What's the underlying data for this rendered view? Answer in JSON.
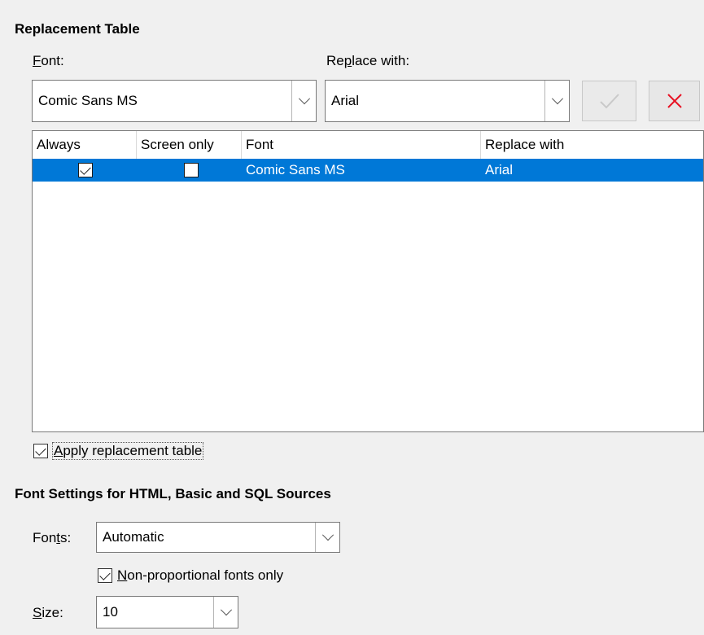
{
  "replacement": {
    "heading": "Replacement Table",
    "font_label_pre": "",
    "font_label_mn": "F",
    "font_label_post": "ont:",
    "replace_label_pre": "Re",
    "replace_label_mn": "p",
    "replace_label_post": "lace with:",
    "font_value": "Comic Sans MS",
    "replace_value": "Arial",
    "apply_icon": "check-icon",
    "delete_icon": "close-icon",
    "delete_color": "#e81123"
  },
  "table": {
    "columns": [
      "Always",
      "Screen only",
      "Font",
      "Replace with"
    ],
    "rows": [
      {
        "always": true,
        "screen_only": false,
        "font": "Comic Sans MS",
        "replace_with": "Arial"
      }
    ],
    "selected_color": "#0078d7"
  },
  "apply_table": {
    "checked": true,
    "label_mn": "A",
    "label_rest": "pply replacement table"
  },
  "sources": {
    "heading": "Font Settings for HTML, Basic and SQL Sources",
    "fonts_label_pre": "Fon",
    "fonts_label_mn": "t",
    "fonts_label_post": "s:",
    "fonts_value": "Automatic",
    "nonprop_checked": true,
    "nonprop_mn": "N",
    "nonprop_rest": "on-proportional fonts only",
    "size_label_mn": "S",
    "size_label_rest": "ize:",
    "size_value": "10"
  }
}
